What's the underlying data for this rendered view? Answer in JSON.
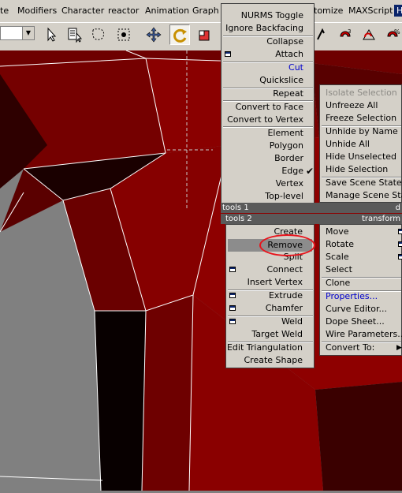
{
  "menubar": {
    "items": [
      "te",
      "Modifiers",
      "Character",
      "reactor",
      "Animation",
      "Graph E",
      "tomize",
      "MAXScript",
      "H"
    ]
  },
  "toolbar": {
    "combo_value": "",
    "icons": [
      "select-arrow-icon",
      "select-by-name-icon",
      "select-region-icon",
      "window-crossing-icon",
      "move-icon",
      "rotate-icon",
      "scale-icon",
      "snap-icon",
      "angle-snap-icon",
      "percent-snap-icon",
      "spinner-snap-icon"
    ]
  },
  "quad_left": {
    "top_items": [
      "NURMS Toggle",
      "Ignore Backfacing",
      "Collapse",
      "Attach",
      "Cut",
      "Quickslice",
      "Repeat",
      "Convert to Face",
      "Convert to Vertex",
      "Element",
      "Polygon",
      "Border",
      "Edge",
      "Vertex",
      "Top-level"
    ],
    "checked_item": "Edge",
    "header_top": "tools 1",
    "header_bottom": "tools 2",
    "bottom_items": [
      "Create",
      "Remove",
      "Split",
      "Connect",
      "Insert Vertex",
      "Extrude",
      "Chamfer",
      "Weld",
      "Target Weld",
      "Edit Triangulation",
      "Create Shape"
    ],
    "highlighted_item": "Remove"
  },
  "quad_right": {
    "header_top": "d",
    "header_bottom": "transform",
    "top_items": [
      "Isolate Selection",
      "Unfreeze All",
      "Freeze Selection",
      "Unhide by Name",
      "Unhide All",
      "Hide Unselected",
      "Hide Selection",
      "Save Scene State...",
      "Manage Scene State"
    ],
    "bottom_items": [
      "Move",
      "Rotate",
      "Scale",
      "Select",
      "Clone",
      "Properties...",
      "Curve Editor...",
      "Dope Sheet...",
      "Wire Parameters...",
      "Convert To:"
    ]
  },
  "colors": {
    "menu_bg": "#d4d0c8",
    "mesh_red": "#7a0000",
    "mesh_dark": "#2a0000",
    "viewport_bg": "#808080",
    "highlight_ring": "#e8141c",
    "selection_blue": "#0a246a"
  }
}
